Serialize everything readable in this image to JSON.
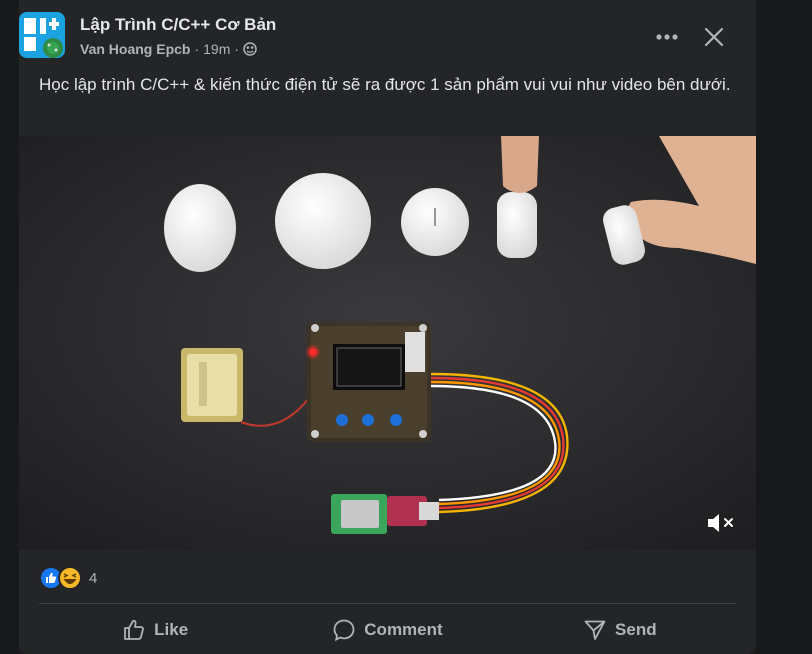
{
  "post": {
    "group_name": "Lập Trình C/C++ Cơ Bản",
    "author": "Van Hoang Epcb",
    "time": "19m",
    "separator": "·",
    "text": "Học lập trình C/C++ & kiến thức điện tử sẽ ra được 1 sản phẩm vui vui như video bên dưới."
  },
  "reactions": {
    "types": [
      "like",
      "haha"
    ],
    "count": "4"
  },
  "actions": {
    "like": "Like",
    "comment": "Comment",
    "send": "Send"
  },
  "colors": {
    "card_bg": "#242526",
    "page_bg": "#18191a",
    "text_primary": "#e4e6eb",
    "text_secondary": "#b0b3b8",
    "like_blue": "#1877f2",
    "haha_yellow": "#f7b928"
  },
  "icons": {
    "more": "more-horizontal-icon",
    "close": "close-icon",
    "audience": "globe-icon",
    "mute": "volume-muted-icon",
    "like": "thumbs-up-icon",
    "comment": "comment-bubble-icon",
    "send": "send-icon"
  }
}
